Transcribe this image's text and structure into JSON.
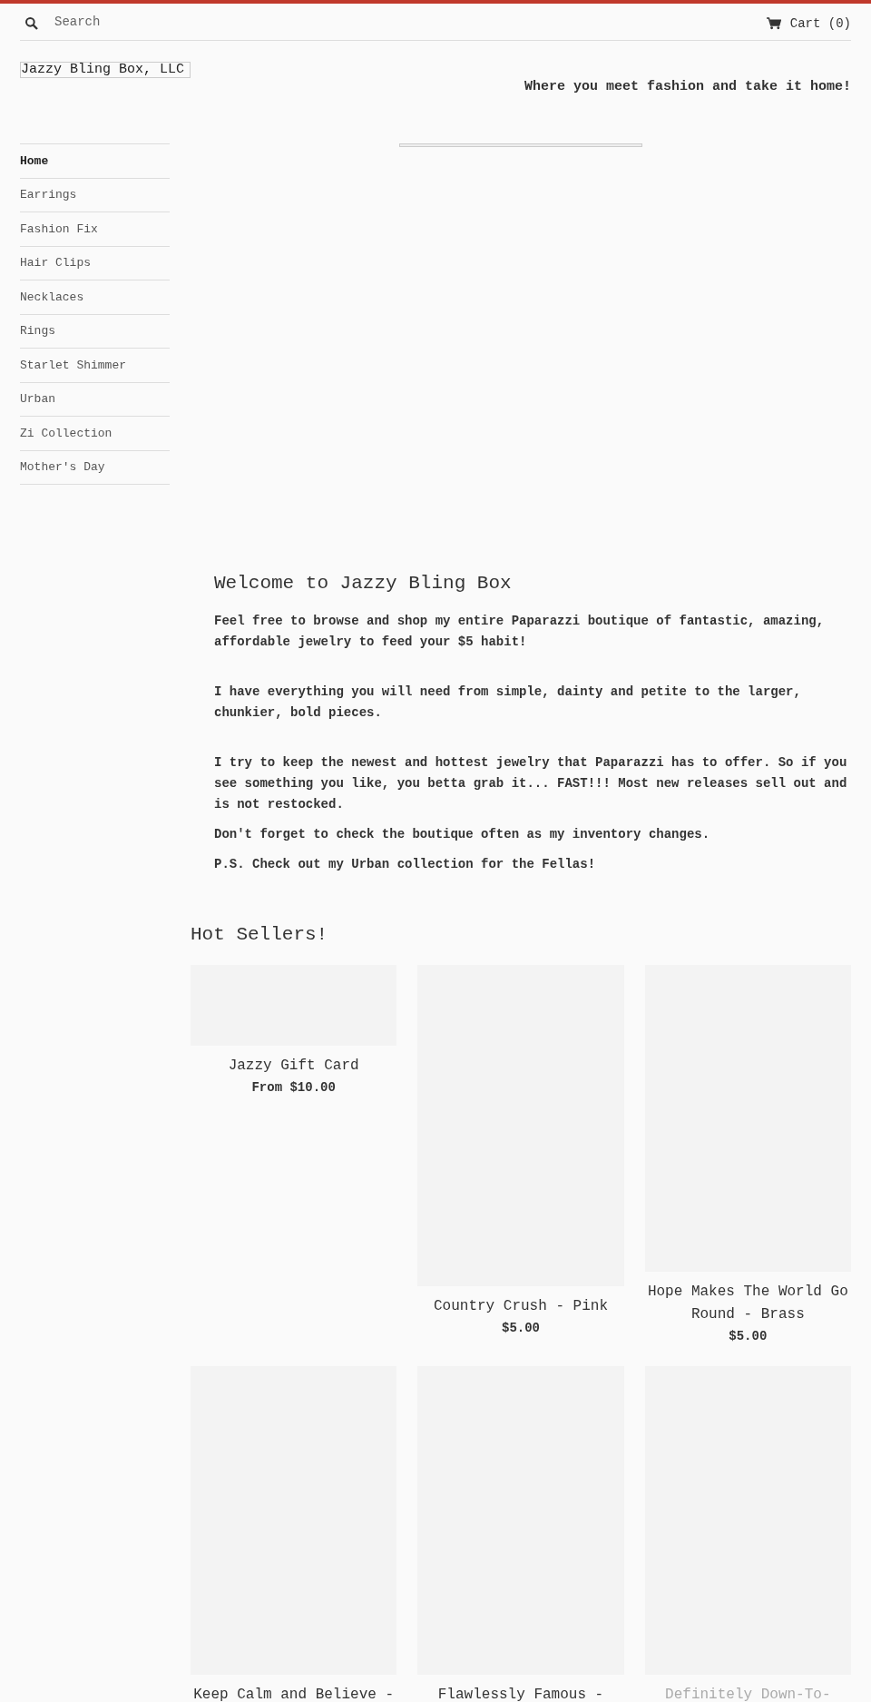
{
  "header": {
    "search": {
      "placeholder": "Search"
    },
    "cart": "Cart (0)"
  },
  "logo": "Jazzy Bling Box, LLC",
  "tagline": "Where you meet fashion and take it home!",
  "sidebar": {
    "items": [
      {
        "label": "Home",
        "selected": true
      },
      {
        "label": "Earrings",
        "selected": false
      },
      {
        "label": "Fashion Fix",
        "selected": false
      },
      {
        "label": "Hair Clips",
        "selected": false
      },
      {
        "label": "Necklaces",
        "selected": false
      },
      {
        "label": "Rings",
        "selected": false
      },
      {
        "label": "Starlet Shimmer",
        "selected": false
      },
      {
        "label": "Urban",
        "selected": false
      },
      {
        "label": "Zi Collection",
        "selected": false
      },
      {
        "label": "Mother's Day",
        "selected": false
      }
    ]
  },
  "welcome": {
    "title": "Welcome to Jazzy Bling Box",
    "paragraphs": [
      "Feel free to browse and shop my entire Paparazzi boutique of fantastic, amazing, affordable jewelry to feed your $5 habit!",
      "I have everything you will need from simple, dainty and petite to the larger, chunkier, bold pieces.",
      "I try to keep the newest and hottest jewelry that Paparazzi has to offer. So if you see something you like, you betta grab it... **FAST**!!! Most new releases sell out and is not restocked.",
      "Don't forget to check the boutique often as my inventory changes.",
      "P.S. Check out my Urban collection for the Fellas!"
    ]
  },
  "hot_sellers": {
    "title": "Hot Sellers!",
    "products": [
      {
        "title": "Jazzy Gift Card",
        "price": "From $10.00",
        "dimmed": false
      },
      {
        "title": "Country Crush - Pink",
        "price": "$5.00",
        "dimmed": false
      },
      {
        "title": "Hope Makes The World Go Round - Brass",
        "price": "$5.00",
        "dimmed": false
      },
      {
        "title": "Keep Calm and Believe -",
        "dimmed": false
      },
      {
        "title": "Flawlessly Famous -",
        "dimmed": false
      },
      {
        "title": "Definitely Down-To-",
        "dimmed": true
      }
    ]
  }
}
